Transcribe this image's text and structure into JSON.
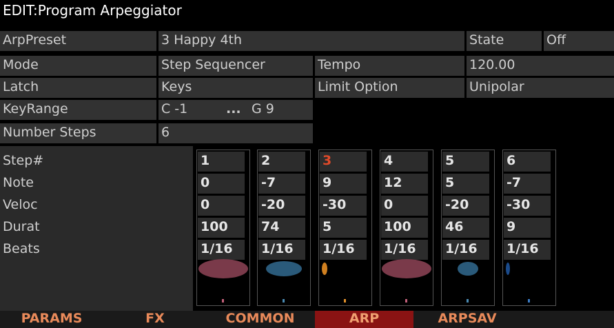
{
  "title": "EDIT:Program Arpeggiator",
  "params": {
    "arp_preset": {
      "label": "ArpPreset",
      "value": "3 Happy 4th"
    },
    "state": {
      "label": "State",
      "value": "Off"
    },
    "mode": {
      "label": "Mode",
      "value": "Step Sequencer"
    },
    "tempo": {
      "label": "Tempo",
      "value": "120.00"
    },
    "latch": {
      "label": "Latch",
      "value": "Keys"
    },
    "limit_option": {
      "label": "Limit Option",
      "value": "Unipolar"
    },
    "key_range": {
      "label": "KeyRange",
      "low": "C -1",
      "sep": "...",
      "high": "G 9"
    },
    "number_steps": {
      "label": "Number Steps",
      "value": "6"
    }
  },
  "row_labels": {
    "step": "Step#",
    "note": "Note",
    "veloc": "Veloc",
    "durat": "Durat",
    "beats": "Beats"
  },
  "steps": [
    {
      "step": "1",
      "note": "0",
      "veloc": "0",
      "durat": "100",
      "beats": "1/16",
      "color": "#7a3a4a",
      "tick_color": "#c2607a",
      "active": false
    },
    {
      "step": "2",
      "note": "-7",
      "veloc": "-20",
      "durat": "74",
      "beats": "1/16",
      "color": "#2a5a7a",
      "tick_color": "#4a8ab2",
      "active": false
    },
    {
      "step": "3",
      "note": "9",
      "veloc": "-30",
      "durat": "5",
      "beats": "1/16",
      "color": "#d08020",
      "tick_color": "#e0902a",
      "active": true
    },
    {
      "step": "4",
      "note": "12",
      "veloc": "0",
      "durat": "100",
      "beats": "1/16",
      "color": "#7a3a4a",
      "tick_color": "#c2607a",
      "active": false
    },
    {
      "step": "5",
      "note": "5",
      "veloc": "-20",
      "durat": "46",
      "beats": "1/16",
      "color": "#2a5a7a",
      "tick_color": "#4a8ab2",
      "active": false
    },
    {
      "step": "6",
      "note": "-7",
      "veloc": "-30",
      "durat": "9",
      "beats": "1/16",
      "color": "#1a4a8a",
      "tick_color": "#3a7ac2",
      "active": false
    }
  ],
  "active_step_color": "#e04a2a",
  "tabs": [
    {
      "label": "PARAMS",
      "active": false
    },
    {
      "label": "FX",
      "active": false
    },
    {
      "label": "COMMON",
      "active": false
    },
    {
      "label": "ARP",
      "active": true
    },
    {
      "label": "ARPSAV",
      "active": false
    },
    {
      "label": "",
      "active": false
    }
  ]
}
